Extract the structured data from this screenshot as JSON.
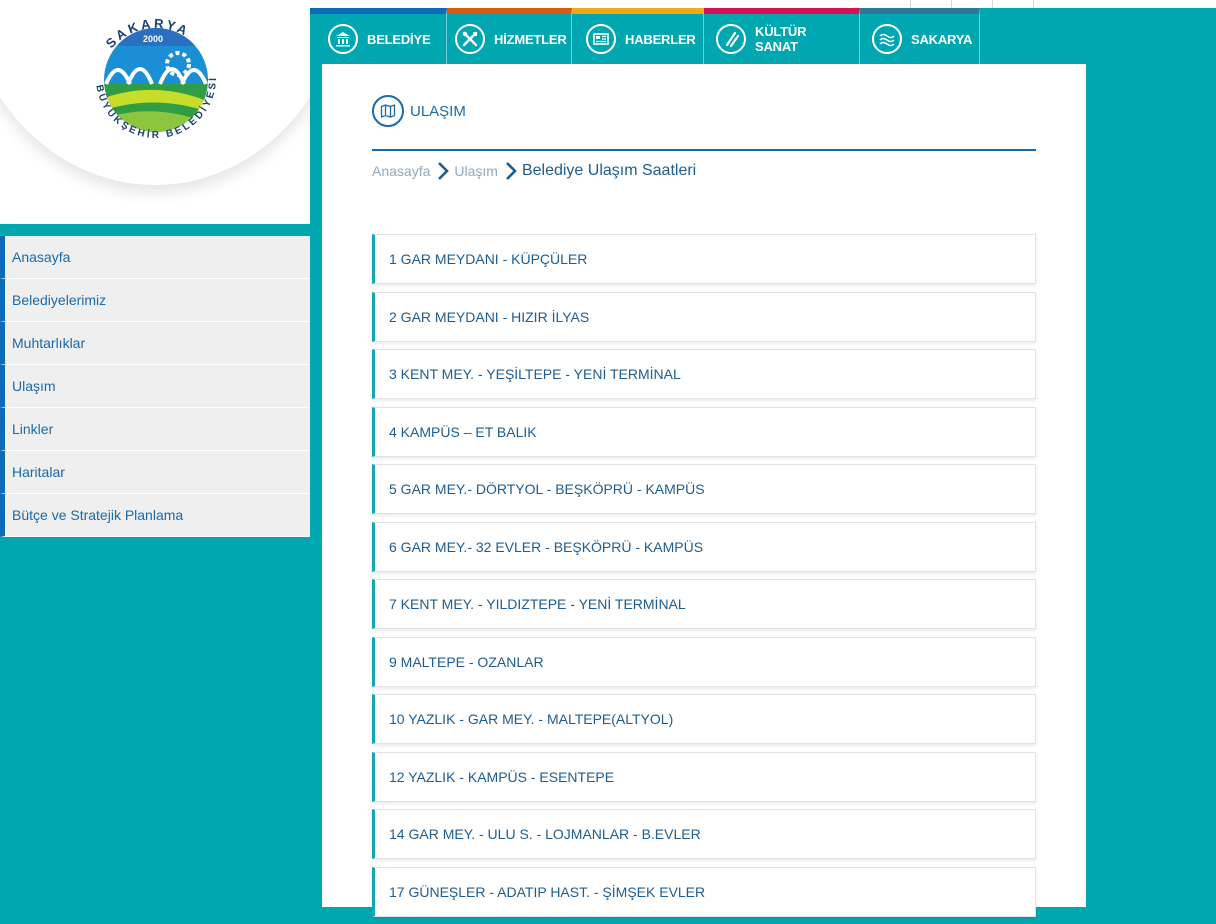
{
  "logo": {
    "arc_text_top": "SAKARYA",
    "arc_text_bottom": "BÜYÜKŞEHİR BELEDİYESİ",
    "year": "2000"
  },
  "sidebar": {
    "items": [
      {
        "label": "Anasayfa"
      },
      {
        "label": "Belediyelerimiz"
      },
      {
        "label": "Muhtarlıklar"
      },
      {
        "label": "Ulaşım"
      },
      {
        "label": "Linkler"
      },
      {
        "label": "Haritalar"
      },
      {
        "label": "Bütçe ve Stratejik Planlama"
      }
    ]
  },
  "topnav": {
    "items": [
      {
        "label": "BELEDİYE",
        "icon": "building-icon",
        "color": "#0b6bb5"
      },
      {
        "label": "HİZMETLER",
        "icon": "tools-icon",
        "color": "#d95b12"
      },
      {
        "label": "HABERLER",
        "icon": "newspaper-icon",
        "color": "#f0a91b"
      },
      {
        "label": "KÜLTÜR SANAT",
        "icon": "brush-icon",
        "color": "#d41256"
      },
      {
        "label": "SAKARYA",
        "icon": "waves-icon",
        "color": "#2b7a9a"
      }
    ]
  },
  "page": {
    "title": "ULAŞIM",
    "title_icon": "map-icon"
  },
  "breadcrumb": {
    "home": "Anasayfa",
    "section": "Ulaşım",
    "current": "Belediye Ulaşım Saatleri"
  },
  "routes": [
    "1 GAR MEYDANI - KÜPÇÜLER",
    "2 GAR MEYDANI - HIZIR İLYAS",
    "3 KENT MEY. - YEŞİLTEPE - YENİ TERMİNAL",
    "4 KAMPÜS – ET BALIK",
    "5 GAR MEY.- DÖRTYOL - BEŞKÖPRÜ - KAMPÜS",
    "6 GAR MEY.- 32 EVLER - BEŞKÖPRÜ - KAMPÜS",
    "7 KENT MEY. - YILDIZTEPE - YENİ TERMİNAL",
    "9 MALTEPE - OZANLAR",
    "10 YAZLIK - GAR MEY. - MALTEPE(ALTYOL)",
    "12 YAZLIK - KAMPÜS - ESENTEPE",
    "14 GAR MEY. - ULU S. - LOJMANLAR - B.EVLER",
    "17 GÜNEŞLER - ADATIP HAST. - ŞİMŞEK EVLER"
  ],
  "colors": {
    "background": "#00a7b1",
    "primary_blue": "#1a6aa8",
    "accent_teal": "#0eaab8"
  }
}
